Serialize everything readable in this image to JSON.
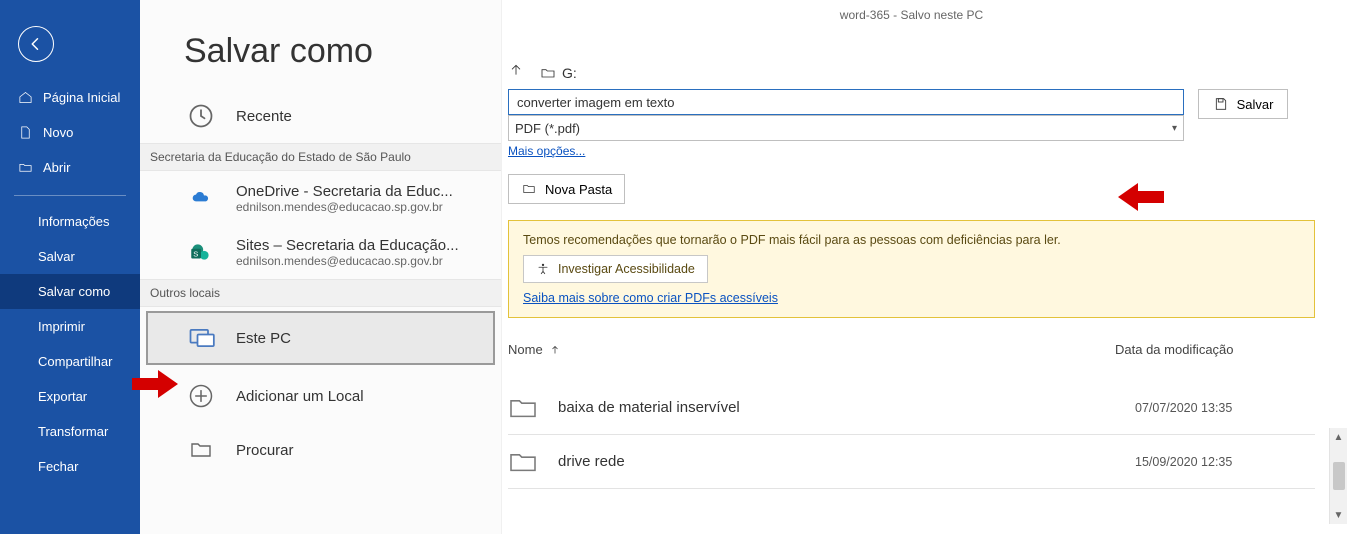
{
  "window_title": "word-365  -  Salvo neste PC",
  "sidebar": {
    "home": "Página Inicial",
    "new": "Novo",
    "open": "Abrir",
    "items": [
      {
        "label": "Informações"
      },
      {
        "label": "Salvar"
      },
      {
        "label": "Salvar como"
      },
      {
        "label": "Imprimir"
      },
      {
        "label": "Compartilhar"
      },
      {
        "label": "Exportar"
      },
      {
        "label": "Transformar"
      },
      {
        "label": "Fechar"
      }
    ]
  },
  "page_title": "Salvar como",
  "locations": {
    "recent": "Recente",
    "group1_header": "Secretaria da Educação do Estado de São Paulo",
    "onedrive": {
      "title": "OneDrive - Secretaria da Educ...",
      "sub": "ednilson.mendes@educacao.sp.gov.br"
    },
    "sites": {
      "title": "Sites – Secretaria da Educação...",
      "sub": "ednilson.mendes@educacao.sp.gov.br"
    },
    "group2_header": "Outros locais",
    "thispc": "Este PC",
    "addloc": "Adicionar um Local",
    "browse": "Procurar"
  },
  "path_drive": "G:",
  "filename": "converter imagem em texto",
  "filetype": "PDF (*.pdf)",
  "more_options": "Mais opções...",
  "save_label": "Salvar",
  "new_folder": "Nova Pasta",
  "accessibility": {
    "msg": "Temos recomendações que tornarão o PDF mais fácil para as pessoas com deficiências para ler.",
    "btn": "Investigar Acessibilidade",
    "link": "Saiba mais sobre como criar PDFs acessíveis"
  },
  "columns": {
    "name": "Nome",
    "date": "Data da modificação"
  },
  "files": [
    {
      "name": "baixa de material inservível",
      "date": "07/07/2020 13:35"
    },
    {
      "name": "drive rede",
      "date": "15/09/2020 12:35"
    }
  ]
}
